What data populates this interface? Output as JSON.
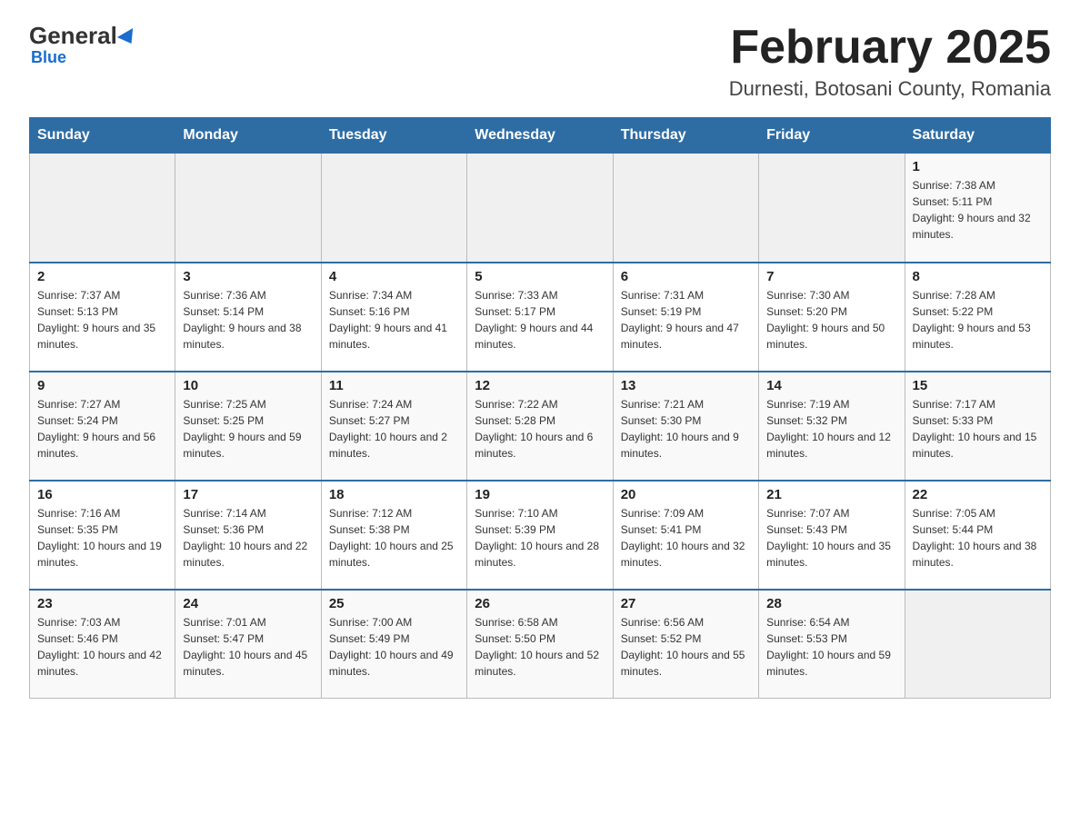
{
  "header": {
    "logo_text": "General",
    "logo_blue": "Blue",
    "main_title": "February 2025",
    "subtitle": "Durnesti, Botosani County, Romania"
  },
  "days_of_week": [
    "Sunday",
    "Monday",
    "Tuesday",
    "Wednesday",
    "Thursday",
    "Friday",
    "Saturday"
  ],
  "weeks": [
    [
      {
        "day": "",
        "info": ""
      },
      {
        "day": "",
        "info": ""
      },
      {
        "day": "",
        "info": ""
      },
      {
        "day": "",
        "info": ""
      },
      {
        "day": "",
        "info": ""
      },
      {
        "day": "",
        "info": ""
      },
      {
        "day": "1",
        "info": "Sunrise: 7:38 AM\nSunset: 5:11 PM\nDaylight: 9 hours and 32 minutes."
      }
    ],
    [
      {
        "day": "2",
        "info": "Sunrise: 7:37 AM\nSunset: 5:13 PM\nDaylight: 9 hours and 35 minutes."
      },
      {
        "day": "3",
        "info": "Sunrise: 7:36 AM\nSunset: 5:14 PM\nDaylight: 9 hours and 38 minutes."
      },
      {
        "day": "4",
        "info": "Sunrise: 7:34 AM\nSunset: 5:16 PM\nDaylight: 9 hours and 41 minutes."
      },
      {
        "day": "5",
        "info": "Sunrise: 7:33 AM\nSunset: 5:17 PM\nDaylight: 9 hours and 44 minutes."
      },
      {
        "day": "6",
        "info": "Sunrise: 7:31 AM\nSunset: 5:19 PM\nDaylight: 9 hours and 47 minutes."
      },
      {
        "day": "7",
        "info": "Sunrise: 7:30 AM\nSunset: 5:20 PM\nDaylight: 9 hours and 50 minutes."
      },
      {
        "day": "8",
        "info": "Sunrise: 7:28 AM\nSunset: 5:22 PM\nDaylight: 9 hours and 53 minutes."
      }
    ],
    [
      {
        "day": "9",
        "info": "Sunrise: 7:27 AM\nSunset: 5:24 PM\nDaylight: 9 hours and 56 minutes."
      },
      {
        "day": "10",
        "info": "Sunrise: 7:25 AM\nSunset: 5:25 PM\nDaylight: 9 hours and 59 minutes."
      },
      {
        "day": "11",
        "info": "Sunrise: 7:24 AM\nSunset: 5:27 PM\nDaylight: 10 hours and 2 minutes."
      },
      {
        "day": "12",
        "info": "Sunrise: 7:22 AM\nSunset: 5:28 PM\nDaylight: 10 hours and 6 minutes."
      },
      {
        "day": "13",
        "info": "Sunrise: 7:21 AM\nSunset: 5:30 PM\nDaylight: 10 hours and 9 minutes."
      },
      {
        "day": "14",
        "info": "Sunrise: 7:19 AM\nSunset: 5:32 PM\nDaylight: 10 hours and 12 minutes."
      },
      {
        "day": "15",
        "info": "Sunrise: 7:17 AM\nSunset: 5:33 PM\nDaylight: 10 hours and 15 minutes."
      }
    ],
    [
      {
        "day": "16",
        "info": "Sunrise: 7:16 AM\nSunset: 5:35 PM\nDaylight: 10 hours and 19 minutes."
      },
      {
        "day": "17",
        "info": "Sunrise: 7:14 AM\nSunset: 5:36 PM\nDaylight: 10 hours and 22 minutes."
      },
      {
        "day": "18",
        "info": "Sunrise: 7:12 AM\nSunset: 5:38 PM\nDaylight: 10 hours and 25 minutes."
      },
      {
        "day": "19",
        "info": "Sunrise: 7:10 AM\nSunset: 5:39 PM\nDaylight: 10 hours and 28 minutes."
      },
      {
        "day": "20",
        "info": "Sunrise: 7:09 AM\nSunset: 5:41 PM\nDaylight: 10 hours and 32 minutes."
      },
      {
        "day": "21",
        "info": "Sunrise: 7:07 AM\nSunset: 5:43 PM\nDaylight: 10 hours and 35 minutes."
      },
      {
        "day": "22",
        "info": "Sunrise: 7:05 AM\nSunset: 5:44 PM\nDaylight: 10 hours and 38 minutes."
      }
    ],
    [
      {
        "day": "23",
        "info": "Sunrise: 7:03 AM\nSunset: 5:46 PM\nDaylight: 10 hours and 42 minutes."
      },
      {
        "day": "24",
        "info": "Sunrise: 7:01 AM\nSunset: 5:47 PM\nDaylight: 10 hours and 45 minutes."
      },
      {
        "day": "25",
        "info": "Sunrise: 7:00 AM\nSunset: 5:49 PM\nDaylight: 10 hours and 49 minutes."
      },
      {
        "day": "26",
        "info": "Sunrise: 6:58 AM\nSunset: 5:50 PM\nDaylight: 10 hours and 52 minutes."
      },
      {
        "day": "27",
        "info": "Sunrise: 6:56 AM\nSunset: 5:52 PM\nDaylight: 10 hours and 55 minutes."
      },
      {
        "day": "28",
        "info": "Sunrise: 6:54 AM\nSunset: 5:53 PM\nDaylight: 10 hours and 59 minutes."
      },
      {
        "day": "",
        "info": ""
      }
    ]
  ]
}
